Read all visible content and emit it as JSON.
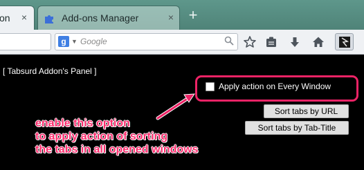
{
  "tabs": [
    {
      "label": "on",
      "close": "×"
    },
    {
      "label": "Add-ons Manager",
      "close": "×"
    }
  ],
  "new_tab_label": "+",
  "search": {
    "placeholder": "Google",
    "engine_letter": "g"
  },
  "panel": {
    "title": "[ Tabsurd Addon's Panel ]",
    "option_label": "Apply action on Every Window",
    "option_checked": false,
    "buttons": {
      "sort_url": "Sort tabs by URL",
      "sort_title": "Sort tabs by Tab-Title"
    }
  },
  "annotation": {
    "lines": [
      "enable this option",
      "to apply action of sorting",
      "the tabs in all opened windows"
    ],
    "color": "#ff2d6e"
  },
  "colors": {
    "highlight": "#ee2366",
    "panel_bg": "#000000",
    "tabstrip": "#5a8f85"
  }
}
